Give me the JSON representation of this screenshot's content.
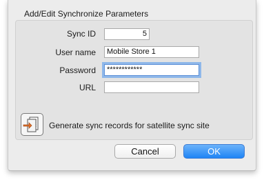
{
  "dialog": {
    "title": "Add/Edit Synchronize Parameters",
    "fields": {
      "sync_id": {
        "label": "Sync ID",
        "value": "5"
      },
      "user_name": {
        "label": "User name",
        "value": "Mobile Store 1"
      },
      "password": {
        "label": "Password",
        "value": "************"
      },
      "url": {
        "label": "URL",
        "value": ""
      }
    },
    "generate": {
      "label": "Generate sync records for satellite sync site",
      "icon": "generate-records-icon"
    },
    "buttons": {
      "cancel": "Cancel",
      "ok": "OK"
    }
  },
  "colors": {
    "ok_button": "#1f84f5",
    "focus_ring": "#8fb8ea",
    "dialog_bg": "#ececec"
  }
}
